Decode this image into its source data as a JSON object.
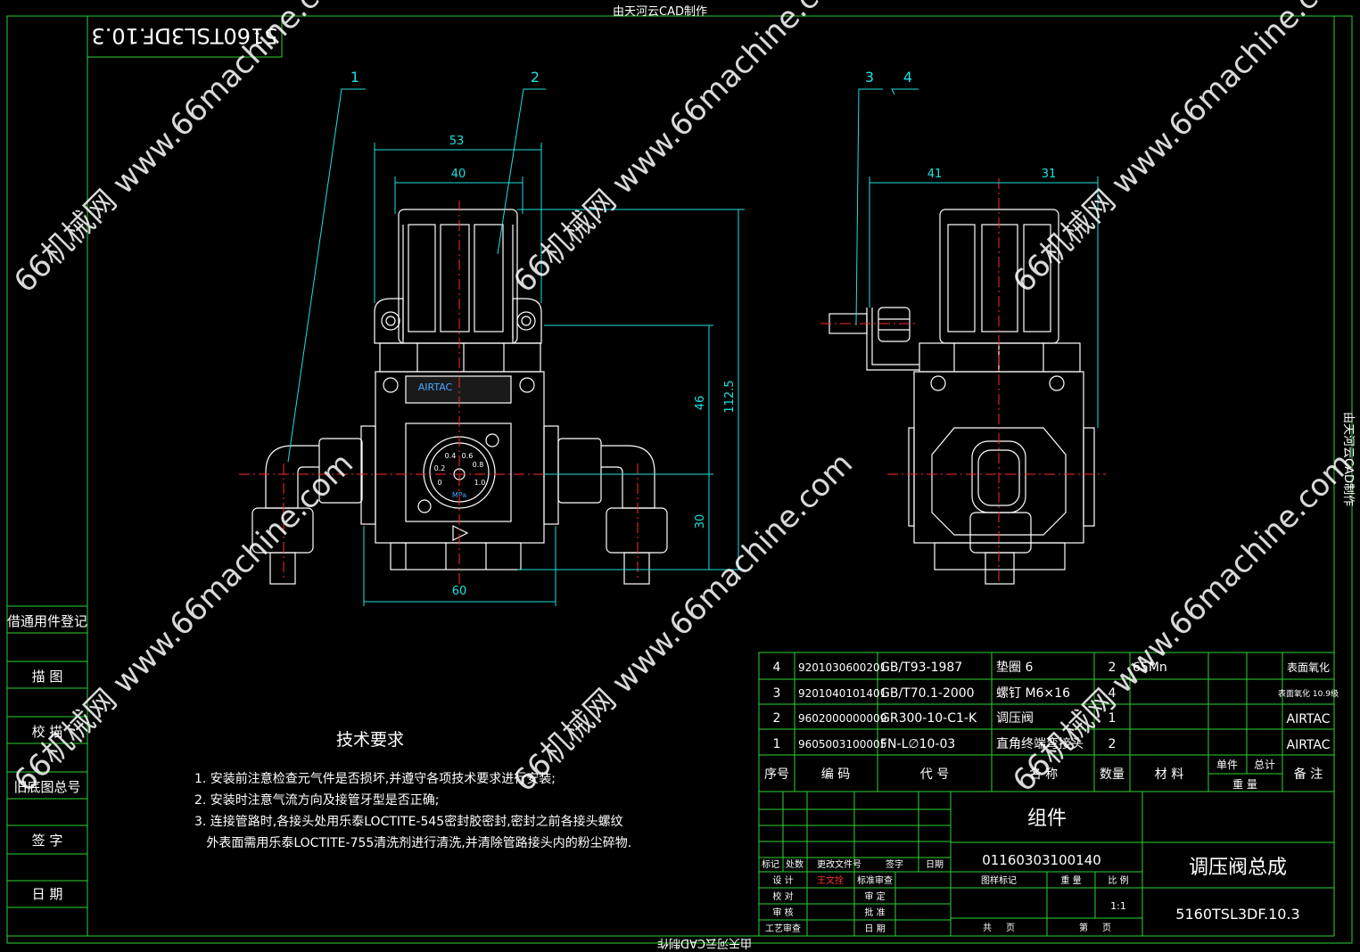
{
  "frame": {
    "top_banner": "由天河云CAD制作",
    "bottom_banner": "由天河云CAD制作",
    "right_banner": "由天河云CAD制作",
    "stamp_code": "5160TSL3DF.10.3"
  },
  "side_panel": [
    "借通用件登记",
    "描  图",
    "校  描",
    "旧底图总号",
    "签  字",
    "日  期"
  ],
  "balloons": [
    "1",
    "2",
    "3",
    "4"
  ],
  "dimensions": {
    "width_53": "53",
    "width_40": "40",
    "width_60": "60",
    "height_112_5": "112.5",
    "height_46": "46",
    "height_30": "30",
    "side_41": "41",
    "side_31": "31"
  },
  "regulator_face": {
    "brand": "AIRTAC",
    "gauge_ticks": [
      "0",
      "0.2",
      "0.4",
      "0.6",
      "0.8",
      "1.0"
    ],
    "gauge_unit": "MPa"
  },
  "technical_requirements": {
    "title": "技术要求",
    "items": [
      "1. 安装前注意检查元气件是否损坏,并遵守各项技术要求进行安装;",
      "2. 安装时注意气流方向及接管牙型是否正确;",
      "3. 连接管路时,各接头处用乐泰LOCTITE-545密封胶密封,密封之前各接头螺纹",
      "   外表面需用乐泰LOCTITE-755清洗剂进行清洗,并清除管路接头内的粉尘碎物."
    ]
  },
  "bom": {
    "rows": [
      {
        "no": "4",
        "code": "9201030600201",
        "std": "GB/T93-1987",
        "name": "垫圈 6",
        "qty": "2",
        "material": "65Mn",
        "remark": "表面氧化"
      },
      {
        "no": "3",
        "code": "9201040101401",
        "std": "GB/T70.1-2000",
        "name": "螺钉 M6×16",
        "qty": "4",
        "material": "",
        "remark": "表面氧化 10.9级"
      },
      {
        "no": "2",
        "code": "9602000000009",
        "std": "GR300-10-C1-K",
        "name": "调压阀",
        "qty": "1",
        "material": "",
        "remark": "AIRTAC"
      },
      {
        "no": "1",
        "code": "9605003100005",
        "std": "FN-L∅10-03",
        "name": "直角终端弯接头",
        "qty": "2",
        "material": "",
        "remark": "AIRTAC"
      }
    ],
    "headers": {
      "no": "序号",
      "code": "编  码",
      "std": "代  号",
      "name": "名  称",
      "qty": "数量",
      "material": "材  料",
      "unit_weight": "单件",
      "total_weight": "总计",
      "weight": "重  量",
      "remark": "备  注"
    }
  },
  "title_block": {
    "assembly_type": "组件",
    "drawing_code": "01160303100140",
    "part_name": "调压阀总成",
    "part_number": "5160TSL3DF.10.3",
    "designer": "王文拴",
    "scale": "1:1",
    "labels": {
      "mark": "标记",
      "count": "处数",
      "change_doc": "更改文件号",
      "sign": "签字",
      "date": "日期",
      "design": "设  计",
      "std_check": "标准审查",
      "verify": "校  对",
      "review": "审  定",
      "audit": "审  核",
      "approve": "批  准",
      "process": "工艺审查",
      "date2": "日  期",
      "stage": "图样标记",
      "weight": "重 量",
      "ratio": "比 例",
      "total_sheets": "共     页",
      "sheet": "第     页"
    }
  },
  "watermark": "66机械网 www.66machine.com"
}
